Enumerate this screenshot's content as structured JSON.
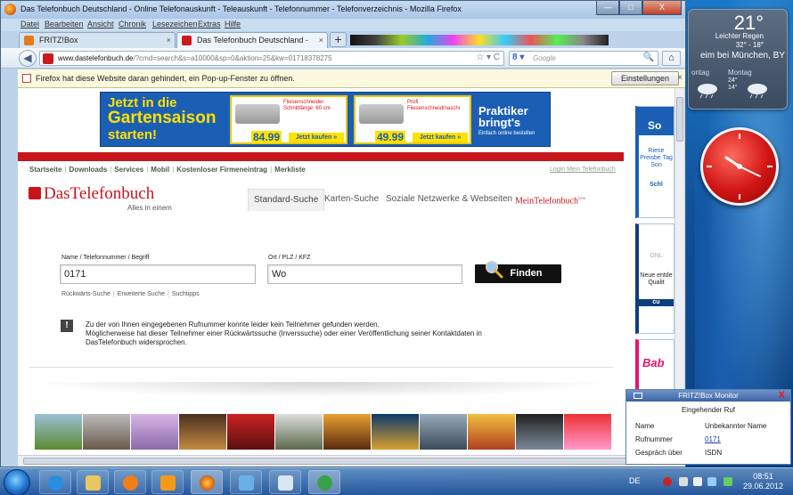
{
  "window": {
    "title": "Das Telefonbuch Deutschland - Online Telefonauskunft - Teleauskunft - Telefonnummer - Telefonverzeichnis - Mozilla Firefox",
    "minimize": "—",
    "maximize": "□",
    "close": "X"
  },
  "menu": [
    "Datei",
    "Bearbeiten",
    "Ansicht",
    "Chronik",
    "Lesezeichen",
    "Extras",
    "Hilfe"
  ],
  "tabs": [
    {
      "label": "FRITZ!Box",
      "close": "×"
    },
    {
      "label": "Das Telefonbuch Deutschland - Onlin...",
      "close": "×"
    }
  ],
  "newtab": "+",
  "nav": {
    "back": "◀",
    "url_domain": "www.dastelefonbuch.de",
    "url_rest": "/?cmd=search&s=a10000&sp=0&aktion=25&kw=01718378275",
    "url_tools": "☆ ▾ C",
    "search_placeholder": "Google",
    "search_engine": "8 ▾",
    "search_icon": "🔍",
    "home": "⌂"
  },
  "popup": {
    "text": "Firefox hat diese Website daran gehindert, ein Pop-up-Fenster zu öffnen.",
    "button": "Einstellungen",
    "close": "×"
  },
  "banner": {
    "line1": "Jetzt in die",
    "line2": "Gartensaison",
    "line3": "starten!",
    "products": [
      {
        "name": "Fliesenschneider Schnittlänge: 60 cm",
        "price": "84.99",
        "cta": "Jetzt kaufen »"
      },
      {
        "name": "Profi Fliesenschneidmaschi",
        "price": "49.99",
        "cta": "Jetzt kaufen »"
      }
    ],
    "logo": "Praktiker",
    "logo_sub": "bringt's",
    "logo_small": "Einfach online bestellen"
  },
  "topnav": [
    "Startseite",
    "Downloads",
    "Services",
    "Mobil",
    "Kostenloser Firmeneintrag",
    "Merkliste"
  ],
  "login": "Login Mein Telefonbuch",
  "brand": {
    "name": "DasTelefonbuch",
    "tagline": "Alles in einem"
  },
  "search_tabs": [
    "Standard-Suche",
    "Karten-Suche",
    "Soziale Netzwerke & Webseiten",
    "MeinTelefonbuch"
  ],
  "search_tabs_beta": "beta",
  "form": {
    "label_name": "Name / Telefonnummer / Begriff",
    "value_name": "0171",
    "label_city": "Ort / PLZ / KFZ",
    "value_city": "Wo",
    "find": "Finden",
    "links": [
      "Rückwärts-Suche",
      "Erweiterte Suche",
      "Suchtipps"
    ]
  },
  "message": {
    "icon": "!",
    "line1": "Zu der von Ihnen eingegebenen Rufnummer konnte leider kein Teilnehmer gefunden werden.",
    "line2": "Möglicherweise hat dieser Teilnehmer einer Rückwärtssuche (Inverssuche) oder einer Veröffentlichung seiner Kontaktdaten in",
    "line3": "DasTelefonbuch widersprochen."
  },
  "right_ads": [
    {
      "t1": "So",
      "t2": "Riese Preisbe Tag Son",
      "t3": "Schl"
    },
    {
      "t1": "ONL",
      "t2": "Neue entde Qualit",
      "t3": "cu"
    },
    {
      "t1": "Bab"
    }
  ],
  "weather": {
    "temp": "21°",
    "cond": "Leichter Regen",
    "range": "32° - 18°",
    "loc": "eim bei München, BY",
    "days": [
      "ontag",
      "Montag"
    ],
    "day1": "",
    "day2": "24°\n14°"
  },
  "fritz": {
    "title": "FRITZ!Box Monitor",
    "close": "X",
    "subtitle": "Eingehender Ruf",
    "rows": [
      {
        "k": "Name",
        "v": "Unbekannter Name"
      },
      {
        "k": "Rufnummer",
        "v": "0171"
      },
      {
        "k": "Gespräch über",
        "v": "ISDN"
      }
    ]
  },
  "tray": {
    "lang": "DE",
    "time": "08:51",
    "date": "29.06.2012"
  },
  "colors": {
    "brand_red": "#c8151b",
    "banner_blue": "#1b5fb5",
    "banner_yellow": "#ffe100"
  }
}
